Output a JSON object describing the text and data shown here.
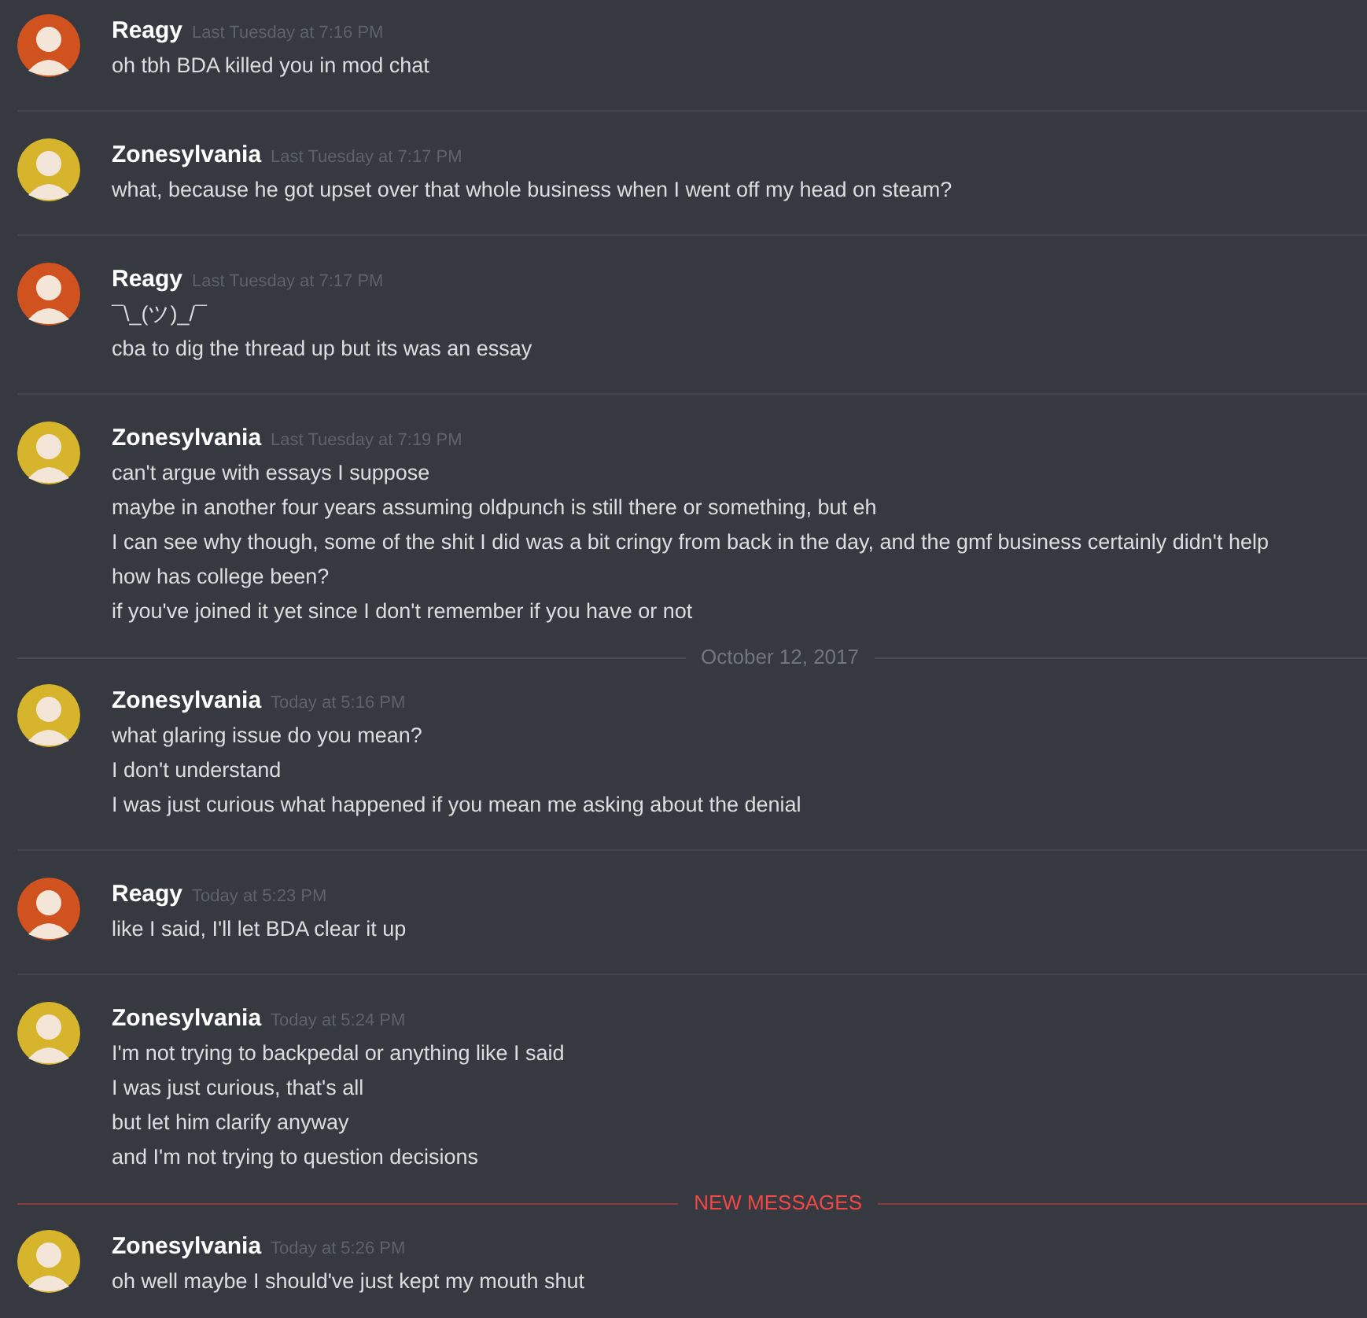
{
  "items": [
    {
      "kind": "message_group",
      "author": "Reagy",
      "color": "#d0521f",
      "timestamp": "Last Tuesday at 7:16 PM",
      "lines": [
        "oh tbh BDA killed you in mod chat"
      ]
    },
    {
      "kind": "message_group",
      "author": "Zonesylvania",
      "color": "#d6b52c",
      "timestamp": "Last Tuesday at 7:17 PM",
      "lines": [
        "what, because he got upset over that whole business when I went off my head on steam?"
      ]
    },
    {
      "kind": "message_group",
      "author": "Reagy",
      "color": "#d0521f",
      "timestamp": "Last Tuesday at 7:17 PM",
      "lines": [
        "¯\\_(ツ)_/¯",
        "cba to dig the thread up but its was an essay"
      ]
    },
    {
      "kind": "message_group",
      "author": "Zonesylvania",
      "color": "#d6b52c",
      "timestamp": "Last Tuesday at 7:19 PM",
      "lines": [
        "can't argue with essays I suppose",
        "maybe in another four years assuming oldpunch is still there or something, but eh",
        "I can see why though, some of the shit I did was a bit cringy from back in the day, and the gmf business certainly didn't help",
        "how has college been?",
        "if you've joined it yet since I don't remember if you have or not"
      ]
    },
    {
      "kind": "date_divider",
      "label": "October 12, 2017"
    },
    {
      "kind": "message_group",
      "author": "Zonesylvania",
      "color": "#d6b52c",
      "timestamp": "Today at 5:16 PM",
      "lines": [
        "what glaring issue do you mean?",
        "I don't understand",
        "I was just curious what happened if you mean me asking about the denial"
      ]
    },
    {
      "kind": "message_group",
      "author": "Reagy",
      "color": "#d0521f",
      "timestamp": "Today at 5:23 PM",
      "lines": [
        "like I said, I'll let BDA clear it up"
      ]
    },
    {
      "kind": "message_group",
      "author": "Zonesylvania",
      "color": "#d6b52c",
      "timestamp": "Today at 5:24 PM",
      "lines": [
        "I'm not trying to backpedal or anything like I said",
        "I was just curious, that's all",
        "but let him clarify anyway",
        "and I'm not trying to question decisions"
      ]
    },
    {
      "kind": "new_divider",
      "label": "NEW MESSAGES"
    },
    {
      "kind": "message_group",
      "author": "Zonesylvania",
      "color": "#d6b52c",
      "timestamp": "Today at 5:26 PM",
      "lines": [
        "oh well maybe I should've just kept my mouth shut"
      ]
    }
  ]
}
